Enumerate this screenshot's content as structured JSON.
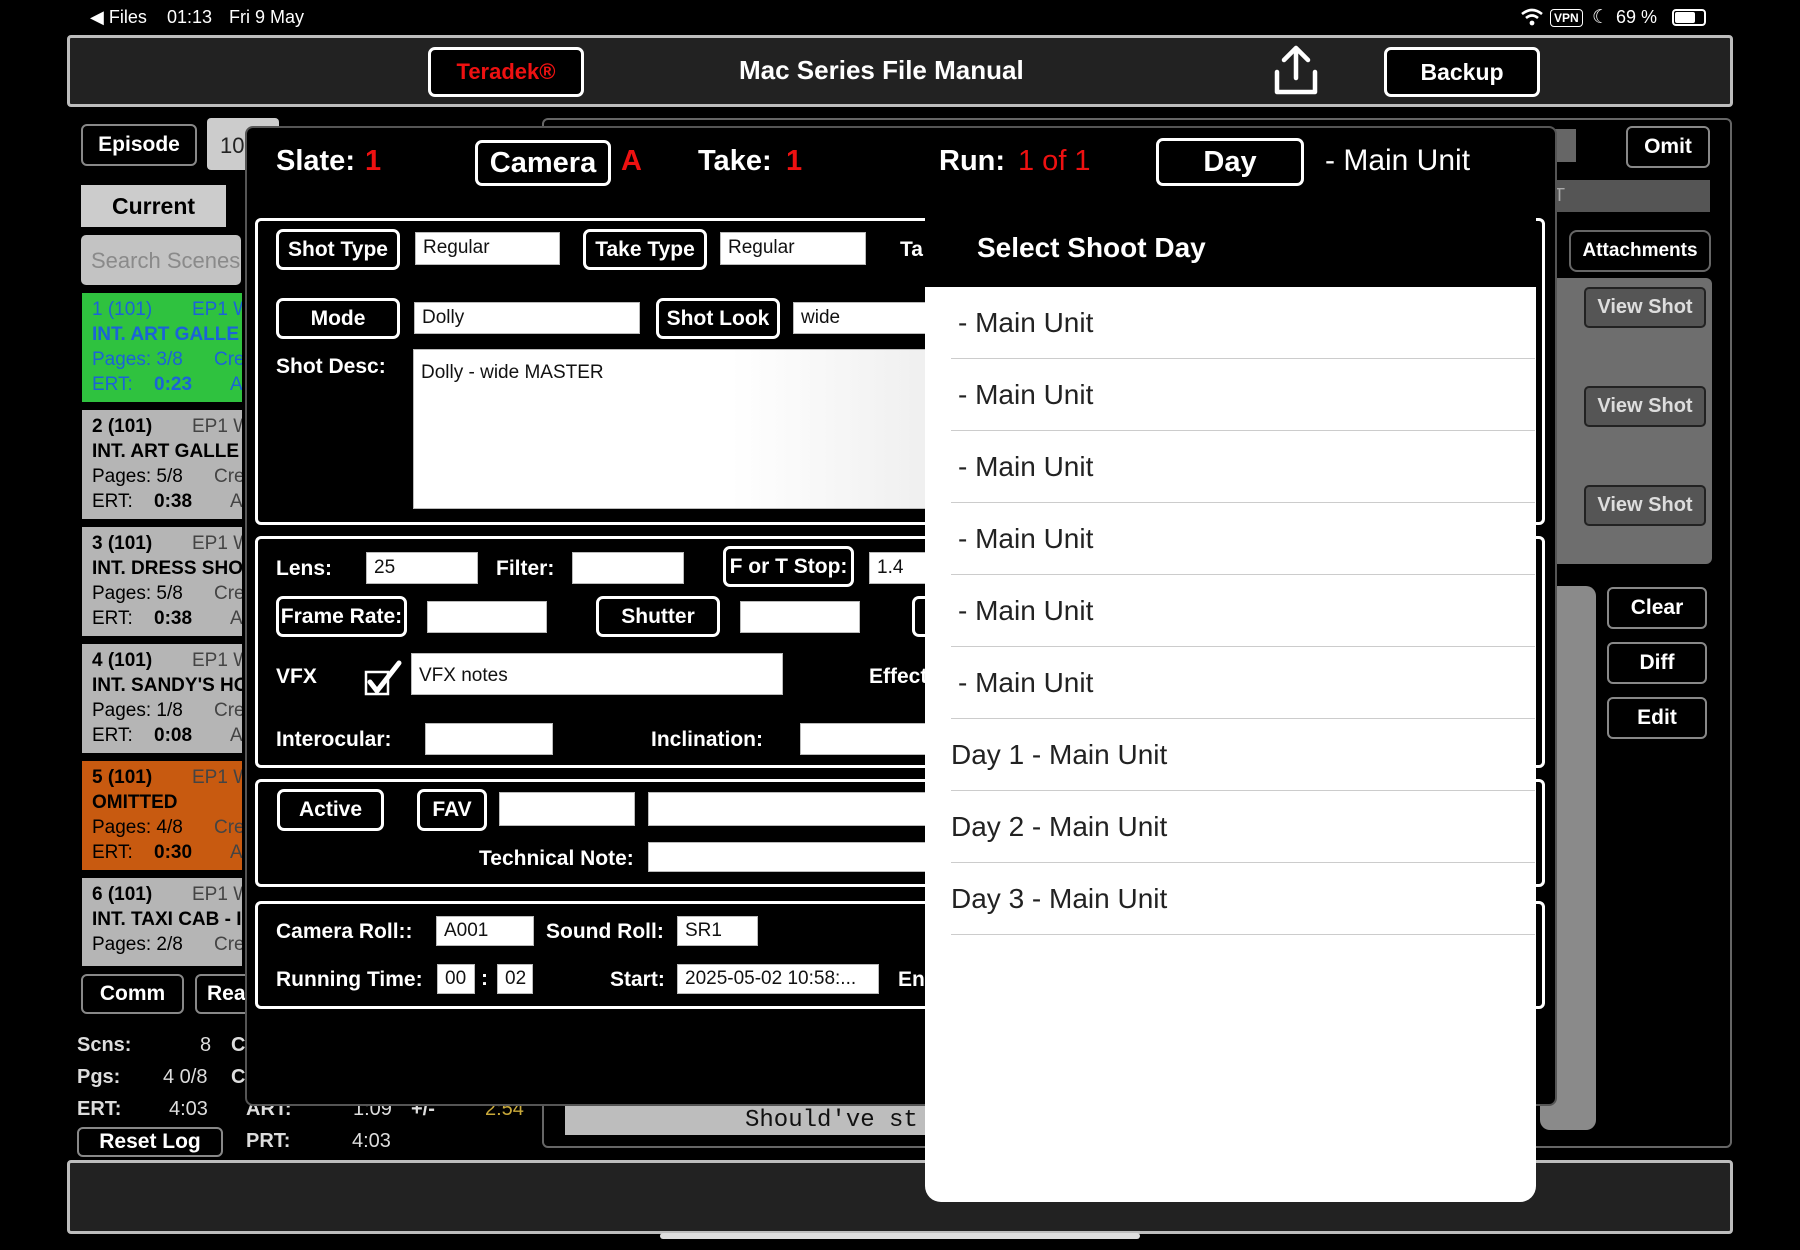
{
  "status_bar": {
    "back": "◀ Files",
    "time": "01:13",
    "date": "Fri 9 May",
    "vpn": "VPN",
    "battery": "69 %"
  },
  "header": {
    "brand": "Teradek®",
    "title": "Mac Series File Manual",
    "backup": "Backup"
  },
  "sidebar": {
    "episode_button": "Episode",
    "episode_value": "10",
    "current_tab": "Current",
    "search_placeholder": "Search Scenes",
    "cards": [
      {
        "line1": "1 (101)",
        "ep": "EP1 W",
        "line2": "INT. ART GALLE",
        "pages": "Pages: 3/8",
        "cre": "Cre",
        "ert": "ERT:",
        "ert_val": "0:23",
        "a": "A"
      },
      {
        "line1": "2 (101)",
        "ep": "EP1 W",
        "line2": "INT. ART GALLE",
        "pages": "Pages: 5/8",
        "cre": "Cre",
        "ert": "ERT:",
        "ert_val": "0:38",
        "a": "A"
      },
      {
        "line1": "3 (101)",
        "ep": "EP1 W",
        "line2": "INT. DRESS SHO",
        "pages": "Pages: 5/8",
        "cre": "Cre",
        "ert": "ERT:",
        "ert_val": "0:38",
        "a": "A"
      },
      {
        "line1": "4 (101)",
        "ep": "EP1 W",
        "line2": "INT. SANDY'S HO",
        "pages": "Pages: 1/8",
        "cre": "Cre",
        "ert": "ERT:",
        "ert_val": "0:08",
        "a": "A"
      },
      {
        "line1": "5 (101)",
        "ep": "EP1 W",
        "line2": "OMITTED",
        "pages": "Pages: 4/8",
        "cre": "Cre",
        "ert": "ERT:",
        "ert_val": "0:30",
        "a": "A"
      },
      {
        "line1": "6 (101)",
        "ep": "EP1 W",
        "line2": "INT. TAXI CAB - I",
        "pages": "Pages: 2/8",
        "cre": "Cre",
        "ert": "",
        "ert_val": "",
        "a": ""
      }
    ],
    "comm_button": "Comm",
    "rea_button": "Rea",
    "stats": {
      "scns_label": "Scns:",
      "scns_value": "8",
      "c1": "C",
      "pgs_label": "Pgs:",
      "pgs_value": "4 0/8",
      "c2": "C",
      "ert_label": "ERT:",
      "ert_value": "4:03",
      "art_label": "ART:",
      "art_value": "1:09",
      "pm_label": "+/-",
      "pm_value": "2:54",
      "prt_label": "PRT:",
      "prt_value": "4:03"
    },
    "reset_log": "Reset Log"
  },
  "right_panel": {
    "omit": "Omit",
    "field_t": "T",
    "attachments": "Attachments",
    "view_shot": "View Shot",
    "clear": "Clear",
    "diff": "Diff",
    "edit": "Edit",
    "note": "Should've st"
  },
  "modal": {
    "slate_label": "Slate:",
    "slate_value": "1",
    "camera_button": "Camera",
    "camera_value": "A",
    "take_label": "Take:",
    "take_value": "1",
    "run_label": "Run:",
    "run_value": "1 of 1",
    "day_button": "Day",
    "day_value": "- Main Unit",
    "shot_type_button": "Shot Type",
    "shot_type_value": "Regular",
    "take_type_button": "Take Type",
    "take_type_value": "Regular",
    "ta_label": "Ta",
    "mode_button": "Mode",
    "mode_value": "Dolly",
    "shot_look_button": "Shot Look",
    "shot_look_value": "wide",
    "shot_desc_label": "Shot Desc:",
    "shot_desc_value": "Dolly - wide MASTER",
    "lens_label": "Lens:",
    "lens_value": "25",
    "filter_label": "Filter:",
    "filter_value": "",
    "fstop_button": "F or T Stop:",
    "fstop_value": "1.4",
    "frame_rate_button": "Frame Rate:",
    "frame_rate_value": "",
    "shutter_button": "Shutter",
    "shutter_value": "",
    "vfx_label": "VFX",
    "vfx_checked": true,
    "vfx_notes": "VFX notes",
    "effect_label": "Effect",
    "interocular_label": "Interocular:",
    "inclination_label": "Inclination:",
    "active_button": "Active",
    "fav_button": "FAV",
    "technical_note_label": "Technical Note:",
    "camera_roll_label": "Camera Roll::",
    "camera_roll_value": "A001",
    "sound_roll_label": "Sound Roll:",
    "sound_roll_value": "SR1",
    "running_time_label": "Running Time:",
    "running_min": "00",
    "running_colon": ":",
    "running_sec": "02",
    "start_label": "Start:",
    "start_value": "2025-05-02 10:58:...",
    "end_label": "En"
  },
  "dropdown": {
    "title": "Select Shoot Day",
    "items": [
      "- Main Unit",
      "- Main Unit",
      "- Main Unit",
      "- Main Unit",
      "- Main Unit",
      "- Main Unit",
      "Day 1 - Main Unit",
      "Day 2 - Main Unit",
      "Day 3 - Main Unit"
    ]
  },
  "colors": {
    "accent_red": "#e11111",
    "card_green": "#2fc23f",
    "card_orange": "#c85a10",
    "scene_blue": "#1b63d8"
  }
}
